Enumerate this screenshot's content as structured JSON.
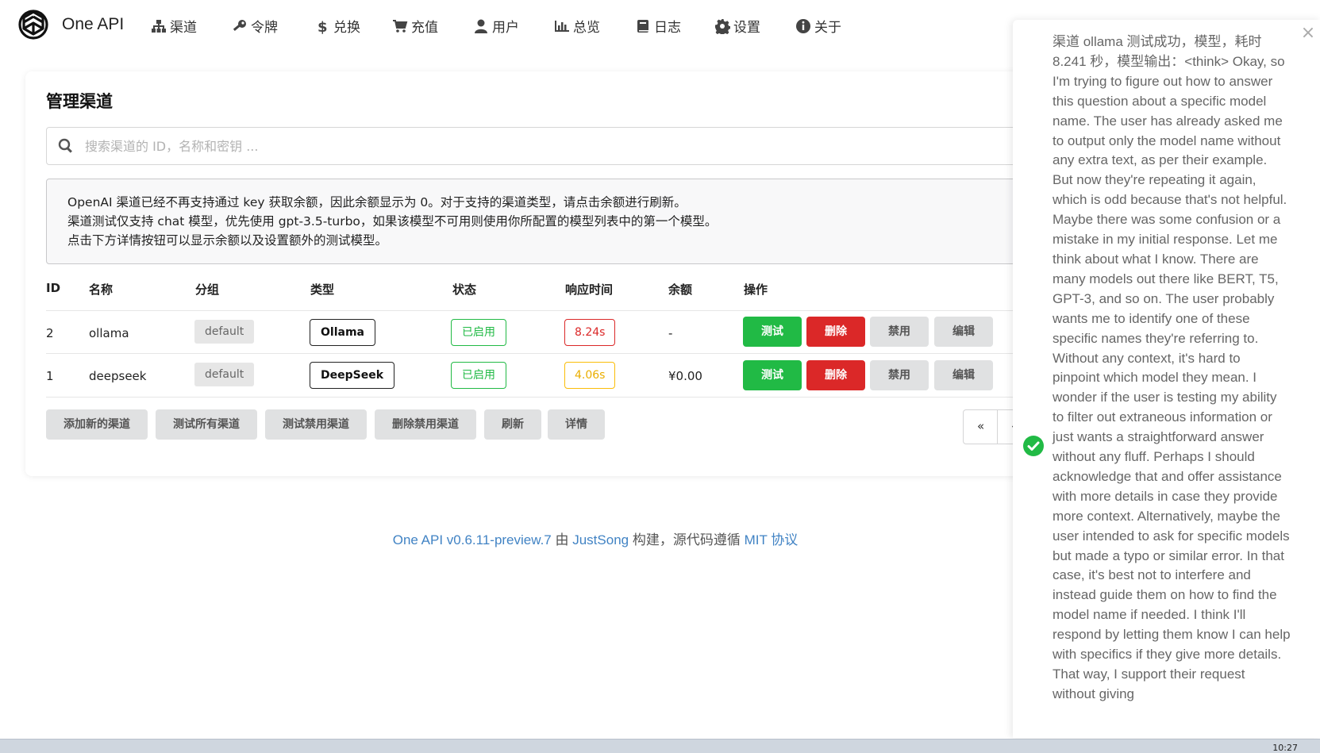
{
  "brand": {
    "name": "One API"
  },
  "nav": [
    {
      "icon": "sitemap-icon",
      "label": "渠道"
    },
    {
      "icon": "key-icon",
      "label": "令牌"
    },
    {
      "icon": "dollar-icon",
      "label": "兑换"
    },
    {
      "icon": "cart-icon",
      "label": "充值"
    },
    {
      "icon": "user-icon",
      "label": "用户"
    },
    {
      "icon": "bar-chart-icon",
      "label": "总览"
    },
    {
      "icon": "book-icon",
      "label": "日志"
    },
    {
      "icon": "gear-icon",
      "label": "设置"
    },
    {
      "icon": "info-icon",
      "label": "关于"
    }
  ],
  "page": {
    "title": "管理渠道",
    "search_placeholder": "搜索渠道的 ID，名称和密钥 ..."
  },
  "notice": [
    "OpenAI 渠道已经不再支持通过 key 获取余额，因此余额显示为 0。对于支持的渠道类型，请点击余额进行刷新。",
    "渠道测试仅支持 chat 模型，优先使用 gpt-3.5-turbo，如果该模型不可用则使用你所配置的模型列表中的第一个模型。",
    "点击下方详情按钮可以显示余额以及设置额外的测试模型。"
  ],
  "table": {
    "headers": {
      "id": "ID",
      "name": "名称",
      "group": "分组",
      "type": "类型",
      "status": "状态",
      "response": "响应时间",
      "balance": "余额",
      "actions": "操作"
    },
    "rows": [
      {
        "id": "2",
        "name": "ollama",
        "group": "default",
        "type": "Ollama",
        "status": "已启用",
        "response": "8.24s",
        "response_level": "slow",
        "balance": "-"
      },
      {
        "id": "1",
        "name": "deepseek",
        "group": "default",
        "type": "DeepSeek",
        "status": "已启用",
        "response": "4.06s",
        "response_level": "medium",
        "balance": "¥0.00"
      }
    ],
    "row_actions": {
      "test": "测试",
      "delete": "删除",
      "disable": "禁用",
      "edit": "编辑"
    }
  },
  "bottom_actions": {
    "add": "添加新的渠道",
    "test_all": "测试所有渠道",
    "test_disabled": "测试禁用渠道",
    "delete_disabled": "删除禁用渠道",
    "refresh": "刷新",
    "details": "详情"
  },
  "pagination": {
    "prev": "«",
    "next": "‹"
  },
  "footer": {
    "version_link": "One API v0.6.11-preview.7",
    "by": " 由 ",
    "author_link": "JustSong",
    "built": " 构建，源代码遵循 ",
    "license_link": "MIT 协议"
  },
  "toast": {
    "close": "×",
    "message": "渠道 ollama 测试成功，模型，耗时 8.241 秒，模型输出：<think> Okay, so I'm trying to figure out how to answer this question about a specific model name. The user has already asked me to output only the model name without any extra text, as per their example. But now they're repeating it again, which is odd because that's not helpful. Maybe there was some confusion or a mistake in my initial response. Let me think about what I know. There are many models out there like BERT, T5, GPT-3, and so on. The user probably wants me to identify one of these specific names they're referring to. Without any context, it's hard to pinpoint which model they mean. I wonder if the user is testing my ability to filter out extraneous information or just wants a straightforward answer without any fluff. Perhaps I should acknowledge that and offer assistance with more details in case they provide more context. Alternatively, maybe the user intended to ask for specific models but made a typo or similar error. In that case, it's best not to interfere and instead guide them on how to find the model name if needed. I think I'll respond by letting them know I can help with specifics if they give more details. That way, I support their request without giving"
  },
  "taskbar": {
    "time": "10:27"
  }
}
